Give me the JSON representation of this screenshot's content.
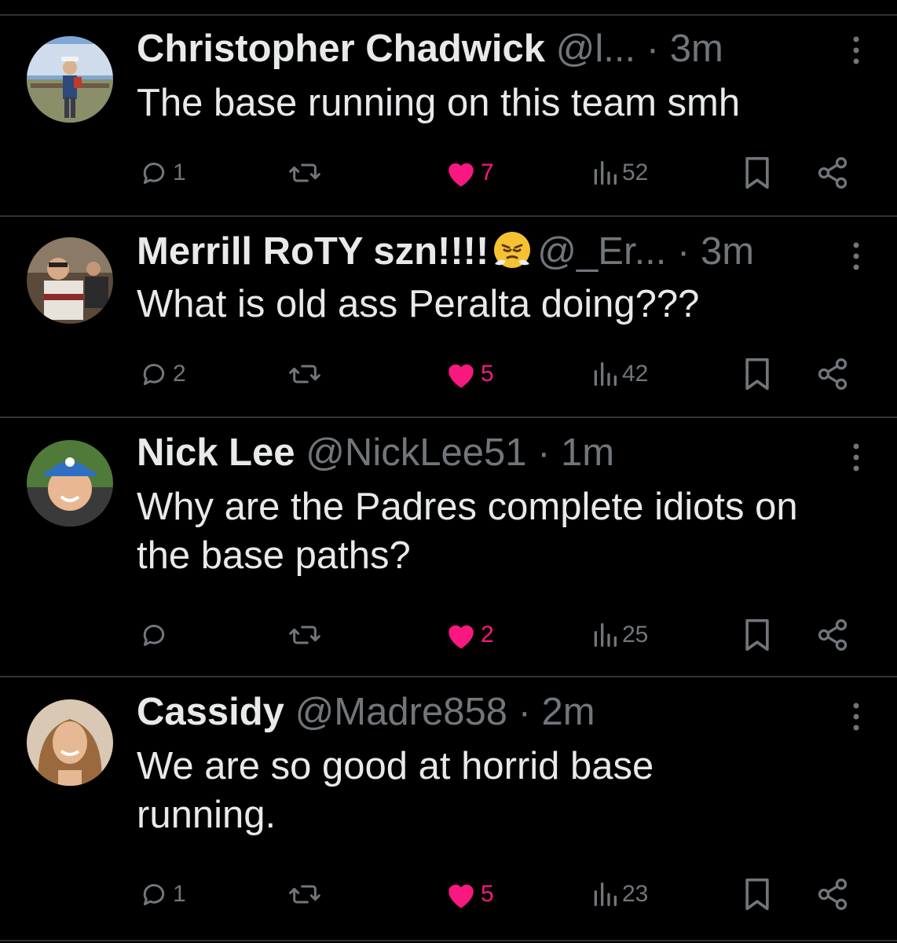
{
  "colors": {
    "background": "#000000",
    "text": "#e7e9ea",
    "muted": "#71767b",
    "like": "#f91880",
    "divider": "#2f3336"
  },
  "tweets": [
    {
      "name": "Christopher Chadwick",
      "handle": "@l...",
      "separator": "·",
      "time": "3m",
      "text": "The base running on this team smh",
      "replies": "1",
      "likes": "7",
      "views": "52",
      "emoji": ""
    },
    {
      "name": "Merrill RoTY szn!!!!",
      "handle": "@_Er...",
      "separator": "·",
      "time": "3m",
      "text": "What is old ass Peralta doing???",
      "replies": "2",
      "likes": "5",
      "views": "42",
      "emoji": "face-with-steam-from-nose"
    },
    {
      "name": "Nick Lee",
      "handle": "@NickLee51",
      "separator": "·",
      "time": "1m",
      "text": "Why are the Padres complete idiots on the base paths?",
      "replies": "",
      "likes": "2",
      "views": "25",
      "emoji": ""
    },
    {
      "name": "Cassidy",
      "handle": "@Madre858",
      "separator": "·",
      "time": "2m",
      "text": "We are so good at horrid base running.",
      "replies": "1",
      "likes": "5",
      "views": "23",
      "emoji": ""
    }
  ],
  "icons": {
    "reply": "reply-icon",
    "retweet": "retweet-icon",
    "like": "heart-icon",
    "views": "views-icon",
    "bookmark": "bookmark-icon",
    "share": "share-icon",
    "more": "more-vertical-icon"
  }
}
